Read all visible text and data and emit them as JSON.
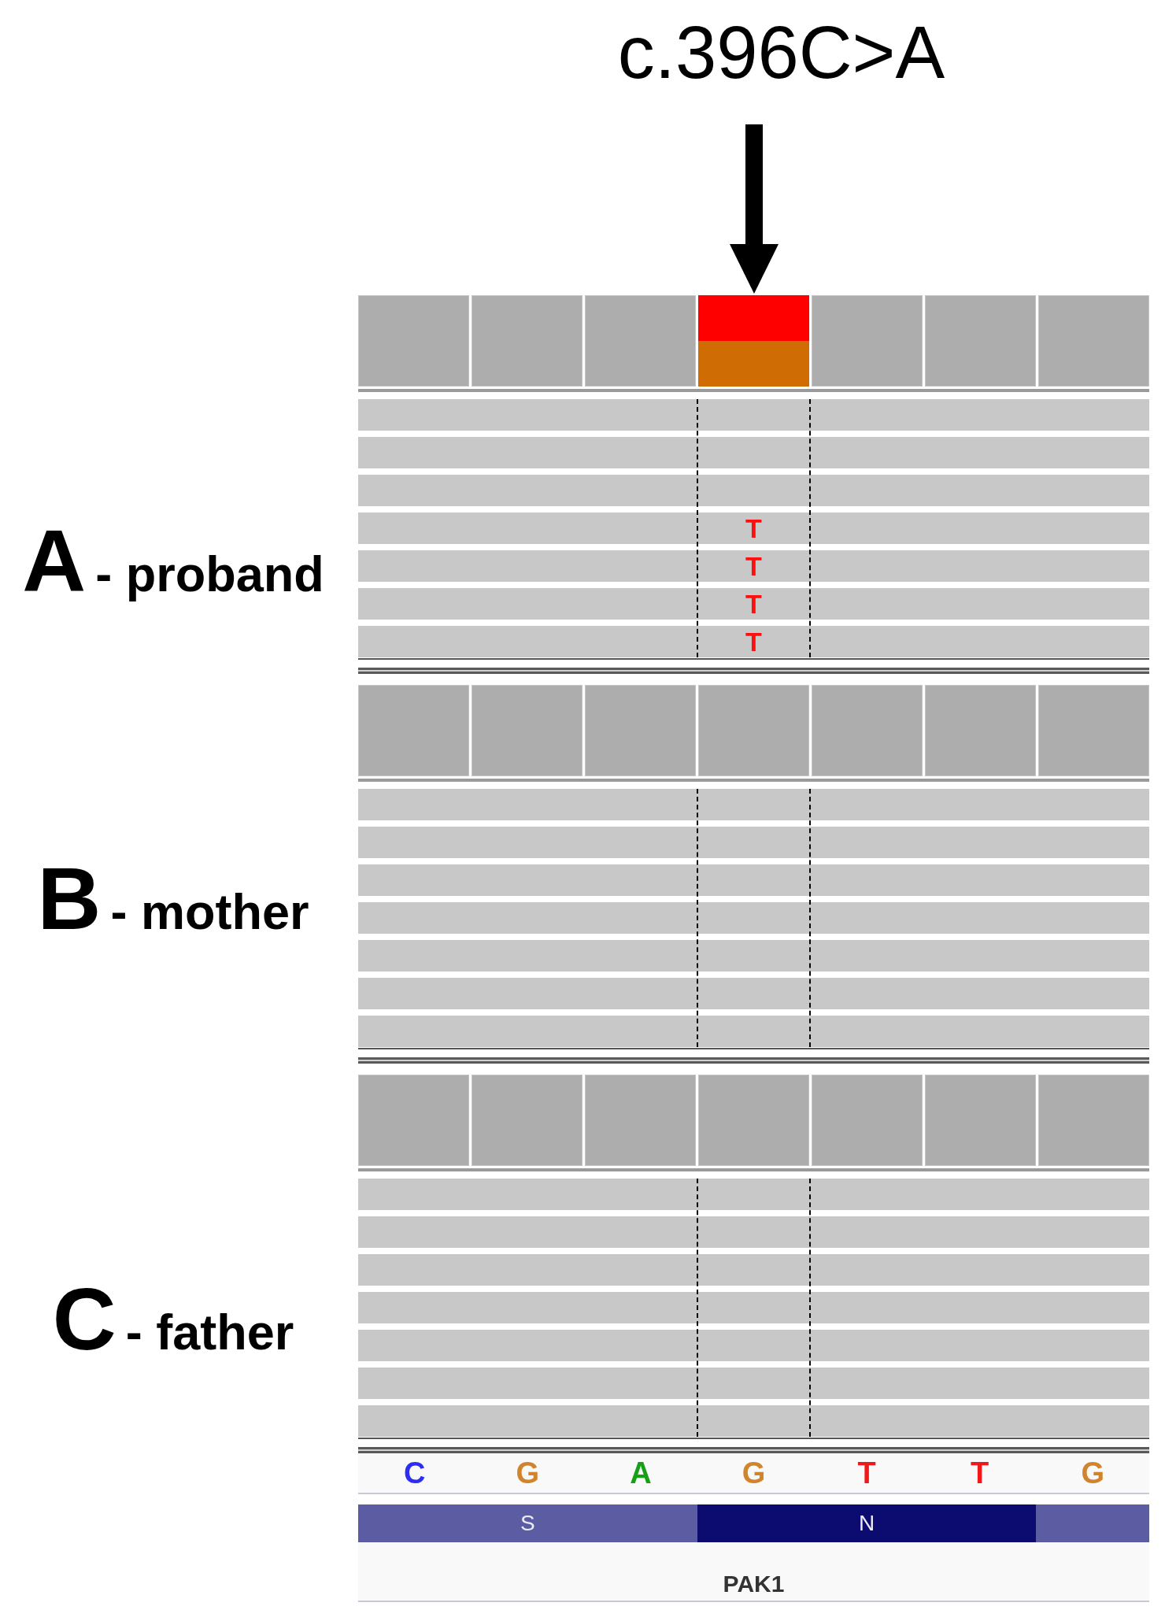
{
  "annotation": {
    "label": "c.396C>A"
  },
  "samples": [
    {
      "letter": "A",
      "label": "- proband",
      "coverage": [
        {
          "kind": "reference"
        },
        {
          "kind": "reference"
        },
        {
          "kind": "reference"
        },
        {
          "kind": "variant",
          "alleles": [
            {
              "color": "#ff0000"
            },
            {
              "color": "#d06c04"
            }
          ]
        },
        {
          "kind": "reference"
        },
        {
          "kind": "reference"
        },
        {
          "kind": "reference"
        }
      ],
      "reads": [
        {
          "kind": "match"
        },
        {
          "kind": "match"
        },
        {
          "kind": "match"
        },
        {
          "kind": "mismatch",
          "base": "T"
        },
        {
          "kind": "mismatch",
          "base": "T"
        },
        {
          "kind": "mismatch",
          "base": "T"
        },
        {
          "kind": "mismatch",
          "base": "T"
        }
      ]
    },
    {
      "letter": "B",
      "label": "- mother",
      "coverage": [
        {
          "kind": "reference"
        },
        {
          "kind": "reference"
        },
        {
          "kind": "reference"
        },
        {
          "kind": "reference"
        },
        {
          "kind": "reference"
        },
        {
          "kind": "reference"
        },
        {
          "kind": "reference"
        }
      ],
      "reads": [
        {
          "kind": "match"
        },
        {
          "kind": "match"
        },
        {
          "kind": "match"
        },
        {
          "kind": "match"
        },
        {
          "kind": "match"
        },
        {
          "kind": "match"
        },
        {
          "kind": "match"
        }
      ]
    },
    {
      "letter": "C",
      "label": "- father",
      "coverage": [
        {
          "kind": "reference"
        },
        {
          "kind": "reference"
        },
        {
          "kind": "reference"
        },
        {
          "kind": "reference"
        },
        {
          "kind": "reference"
        },
        {
          "kind": "reference"
        },
        {
          "kind": "reference"
        }
      ],
      "reads": [
        {
          "kind": "match"
        },
        {
          "kind": "match"
        },
        {
          "kind": "match"
        },
        {
          "kind": "match"
        },
        {
          "kind": "match"
        },
        {
          "kind": "match"
        },
        {
          "kind": "match"
        }
      ]
    }
  ],
  "sequence": [
    {
      "base": "C",
      "color": "#2e2ef0"
    },
    {
      "base": "G",
      "color": "#d1842c"
    },
    {
      "base": "A",
      "color": "#15a015"
    },
    {
      "base": "G",
      "color": "#d1842c"
    },
    {
      "base": "T",
      "color": "#f01818"
    },
    {
      "base": "T",
      "color": "#f01818"
    },
    {
      "base": "G",
      "color": "#d1842c"
    }
  ],
  "gene": {
    "codons": [
      {
        "amino_acid": "S",
        "color": "#5c5ca3"
      },
      {
        "amino_acid": "N",
        "color": "#0c0c70"
      },
      {
        "color": "#5c5ca3"
      }
    ],
    "name": "PAK1"
  }
}
